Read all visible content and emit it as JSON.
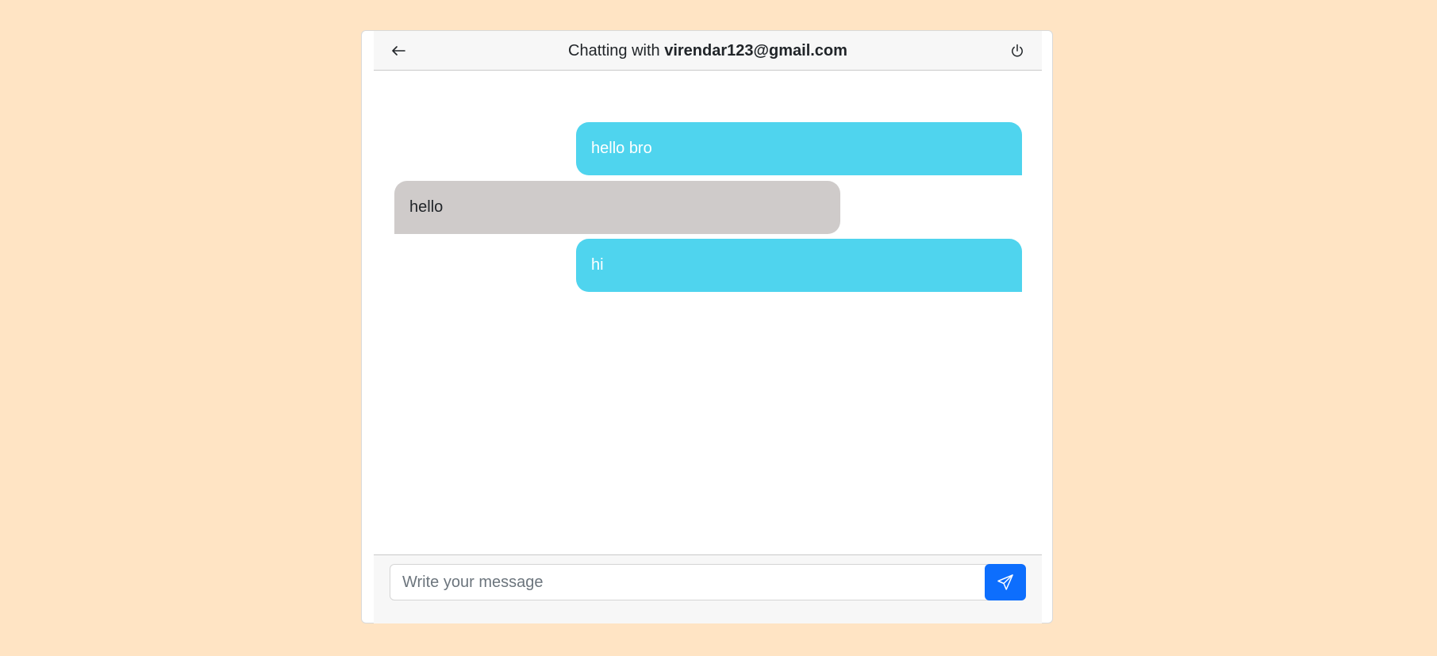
{
  "header": {
    "title_prefix": "Chatting with ",
    "contact_email": "virendar123@gmail.com",
    "back_icon": "arrow-left-icon",
    "logout_icon": "power-icon"
  },
  "messages": [
    {
      "text": "hello bro",
      "direction": "sent"
    },
    {
      "text": "hello",
      "direction": "received"
    },
    {
      "text": "hi",
      "direction": "sent"
    }
  ],
  "composer": {
    "placeholder": "Write your message",
    "value": "",
    "send_icon": "send-icon"
  },
  "colors": {
    "background": "#ffe4c4",
    "sent_bubble": "#4fd4ee",
    "received_bubble": "#cfcbca",
    "send_button": "#0d6efd"
  }
}
